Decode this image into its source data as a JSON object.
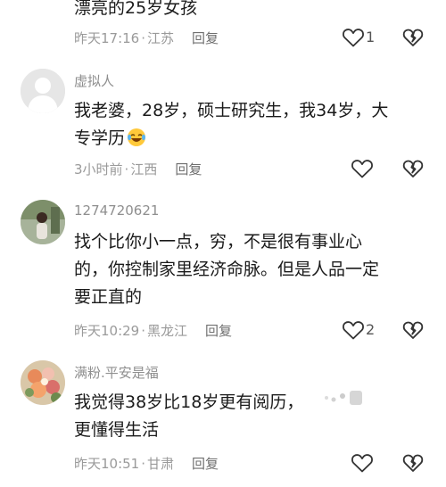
{
  "comments": [
    {
      "text_lines": [
        "漂亮的25岁女孩"
      ],
      "time": "昨天17:16",
      "location": "江苏",
      "reply_label": "回复",
      "like_count": "1"
    },
    {
      "username": "虚拟人",
      "text_lines": [
        "我老婆，28岁，硕士研究生，我34岁，大",
        "专学历"
      ],
      "time": "3小时前",
      "location": "江西",
      "reply_label": "回复",
      "emoji_icon": "laughing-crying-emoji-icon"
    },
    {
      "username": "1274720621",
      "text_lines": [
        "找个比你小一点，穷，不是很有事业心",
        "的，你控制家里经济命脉。但是人品一定",
        "要正直的"
      ],
      "time": "昨天10:29",
      "location": "黑龙江",
      "reply_label": "回复",
      "like_count": "2"
    },
    {
      "username": "满粉.平安是福",
      "text_lines": [
        "我觉得38岁比18岁更有阅历，",
        "更懂得生活"
      ],
      "time": "昨天10:51",
      "location": "甘肃",
      "reply_label": "回复"
    }
  ],
  "separator": "·",
  "icons": {
    "like": "heart-outline-icon",
    "dislike": "broken-heart-outline-icon"
  },
  "colors": {
    "meta_text": "#9a9a9a",
    "username": "#8f8f8f",
    "body_text": "#1a1a1a"
  }
}
